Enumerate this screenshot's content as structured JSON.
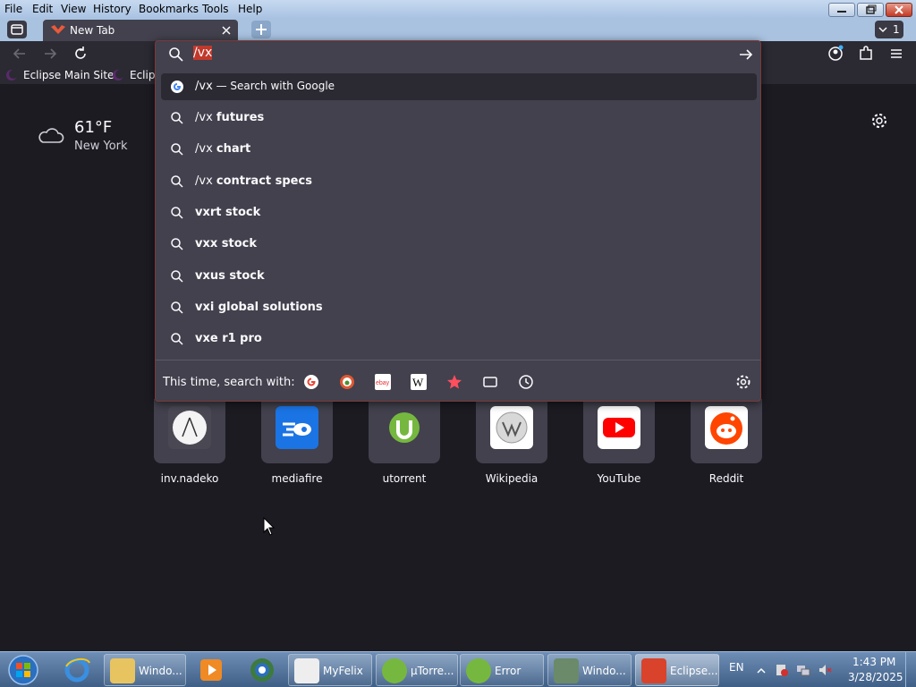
{
  "menubar": {
    "file": "File",
    "edit": "Edit",
    "view": "View",
    "history": "History",
    "bookmarks": "Bookmarks",
    "tools": "Tools",
    "help": "Help"
  },
  "tabs": {
    "newtab_label": "New Tab",
    "count_badge": "1"
  },
  "bookmarks": {
    "items": [
      {
        "label": "Eclipse Main Site"
      },
      {
        "label": "Eclips"
      }
    ]
  },
  "urlbar": {
    "typed": "/vx",
    "suggestions": [
      {
        "prefix": "/vx",
        "rest": " — Search with Google",
        "bold": ""
      },
      {
        "prefix": "/vx ",
        "rest": "",
        "bold": "futures"
      },
      {
        "prefix": "/vx ",
        "rest": "",
        "bold": "chart"
      },
      {
        "prefix": "/vx ",
        "rest": "",
        "bold": "contract specs"
      },
      {
        "prefix": "",
        "rest": "",
        "bold": "vxrt stock"
      },
      {
        "prefix": "",
        "rest": "",
        "bold": "vxx stock"
      },
      {
        "prefix": "",
        "rest": "",
        "bold": "vxus stock"
      },
      {
        "prefix": "",
        "rest": "",
        "bold": "vxi global solutions"
      },
      {
        "prefix": "",
        "rest": "",
        "bold": "vxe r1 pro"
      }
    ],
    "oneoff_label": "This time, search with:"
  },
  "weather": {
    "temp": "61°F",
    "city": "New York"
  },
  "topsites": [
    {
      "label": "inv.nadeko"
    },
    {
      "label": "mediafire"
    },
    {
      "label": "utorrent"
    },
    {
      "label": "Wikipedia"
    },
    {
      "label": "YouTube"
    },
    {
      "label": "Reddit"
    }
  ],
  "taskbar": {
    "buttons": [
      {
        "label": "Windo..."
      },
      {
        "label": "MyFelix"
      },
      {
        "label": "µTorre..."
      },
      {
        "label": "Error"
      },
      {
        "label": "Windo..."
      },
      {
        "label": "Eclipse..."
      }
    ],
    "lang": "EN",
    "time": "1:43 PM",
    "date": "3/28/2025"
  },
  "colors": {
    "accent": "#c0392b",
    "background": "#1c1b22",
    "panel": "#42414d"
  }
}
